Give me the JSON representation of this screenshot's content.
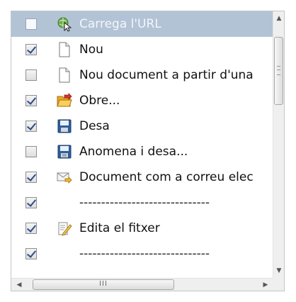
{
  "items": [
    {
      "checked": false,
      "selected": true,
      "icon": "load-url-icon",
      "label": "Carrega l'URL"
    },
    {
      "checked": true,
      "selected": false,
      "icon": "new-document-icon",
      "label": "Nou"
    },
    {
      "checked": false,
      "selected": false,
      "icon": "new-document-icon",
      "label": "Nou document a partir d'una"
    },
    {
      "checked": true,
      "selected": false,
      "icon": "open-folder-icon",
      "label": "Obre..."
    },
    {
      "checked": true,
      "selected": false,
      "icon": "save-icon",
      "label": "Desa"
    },
    {
      "checked": false,
      "selected": false,
      "icon": "save-as-icon",
      "label": "Anomena i desa..."
    },
    {
      "checked": true,
      "selected": false,
      "icon": "email-document-icon",
      "label": "Document com a correu elec"
    },
    {
      "checked": true,
      "selected": false,
      "icon": "",
      "label": "------------------------------"
    },
    {
      "checked": true,
      "selected": false,
      "icon": "edit-file-icon",
      "label": "Edita el fitxer"
    },
    {
      "checked": true,
      "selected": false,
      "icon": "",
      "label": "------------------------------"
    }
  ],
  "scrollbar": {
    "up_arrow": "▲",
    "down_arrow": "▼",
    "left_arrow": "◀",
    "right_arrow": "▶",
    "h_thumb_grip": "III"
  }
}
